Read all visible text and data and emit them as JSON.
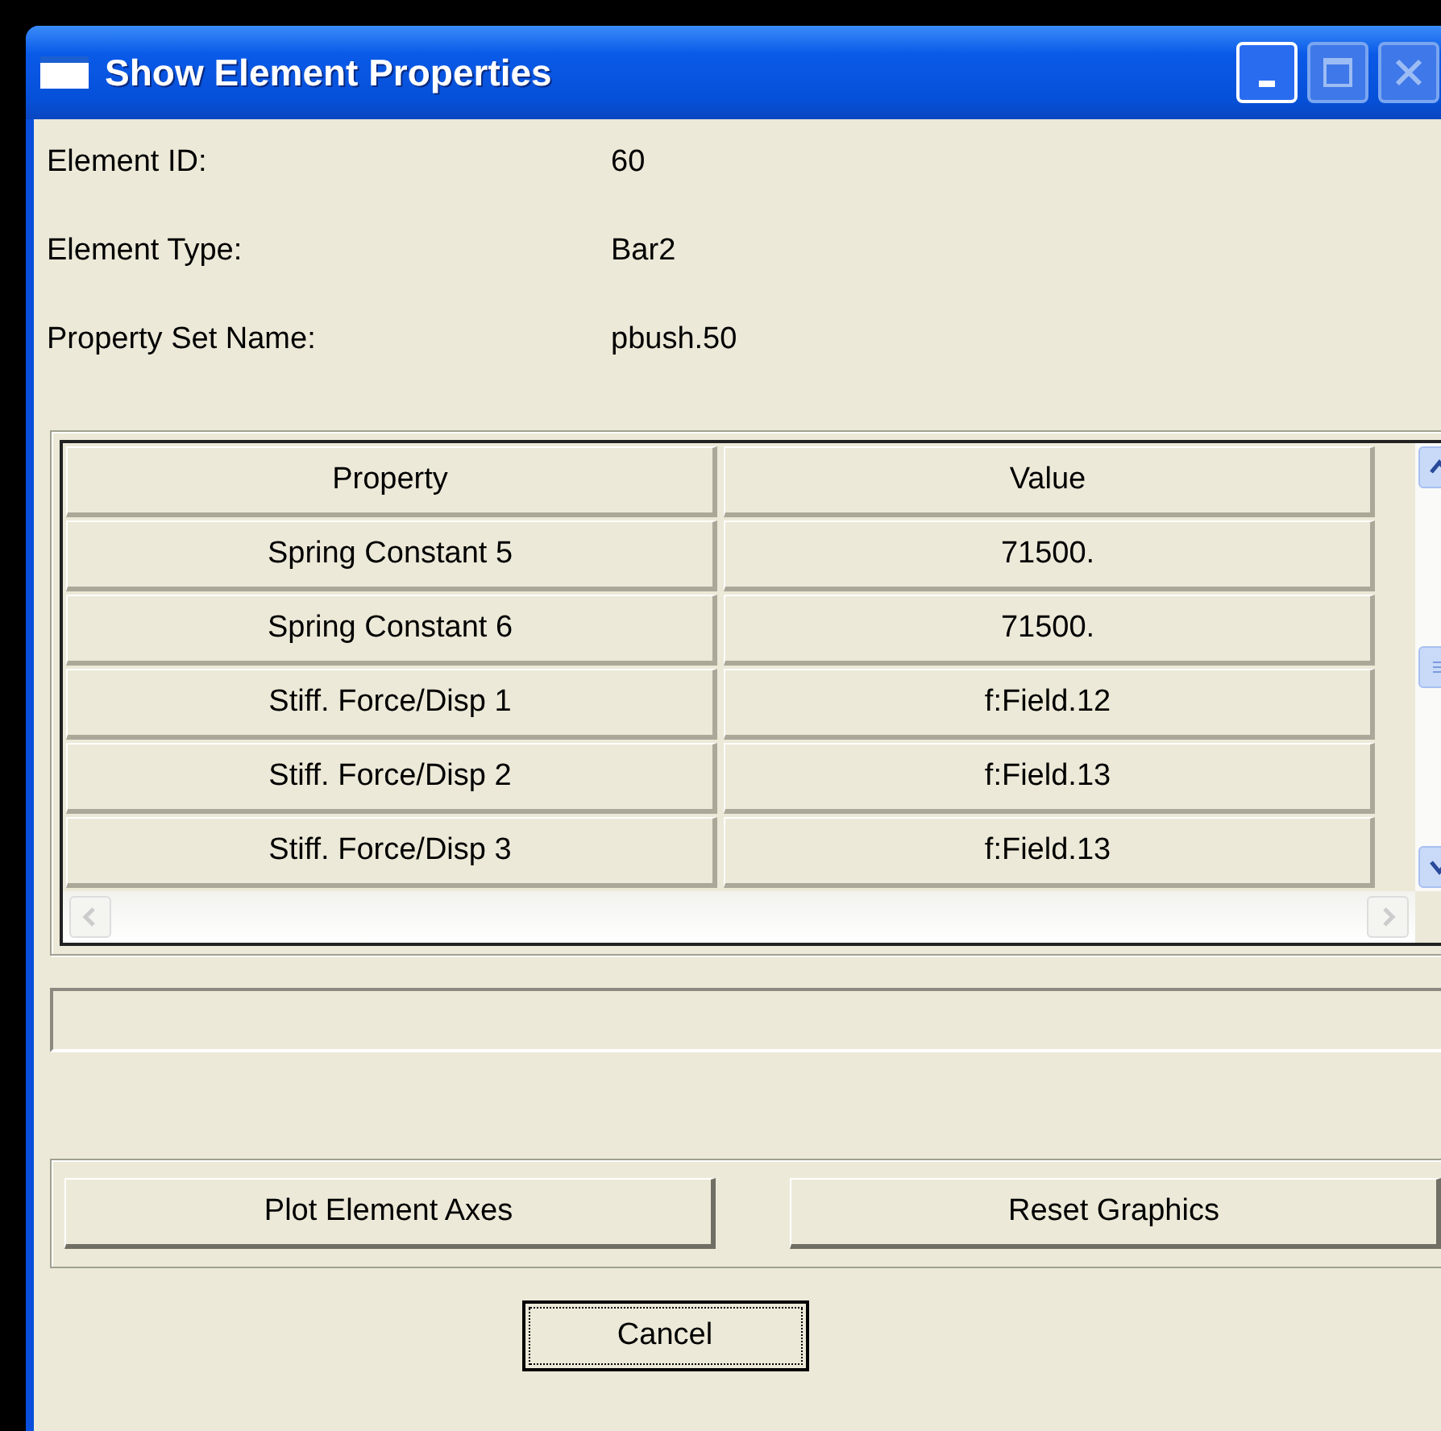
{
  "window": {
    "title": "Show Element Properties",
    "controls": [
      {
        "kind": "minimize",
        "disabled": false
      },
      {
        "kind": "maximize",
        "disabled": true
      },
      {
        "kind": "close",
        "disabled": true
      }
    ]
  },
  "fields": [
    {
      "label": "Element ID:",
      "value": "60"
    },
    {
      "label": "Element Type:",
      "value": "Bar2"
    },
    {
      "label": "Property Set Name:",
      "value": "pbush.50"
    }
  ],
  "table": {
    "columns": [
      "Property",
      "Value"
    ],
    "rows": [
      [
        "Spring Constant 5",
        "71500."
      ],
      [
        "Spring Constant 6",
        "71500."
      ],
      [
        "Stiff. Force/Disp 1",
        "f:Field.12"
      ],
      [
        "Stiff. Force/Disp 2",
        "f:Field.13"
      ],
      [
        "Stiff. Force/Disp 3",
        "f:Field.13"
      ]
    ]
  },
  "actions": [
    {
      "label": "Plot Element Axes"
    },
    {
      "label": "Reset Graphics"
    }
  ],
  "cancel": {
    "label": "Cancel",
    "focused": true
  }
}
